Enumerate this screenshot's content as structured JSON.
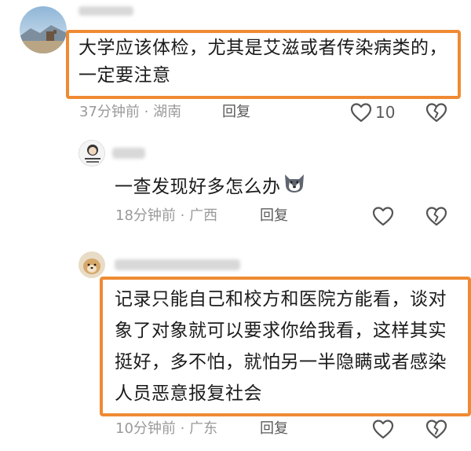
{
  "comments": [
    {
      "text": "大学应该体检，尤其是艾滋或者传染病类的，一定要注意",
      "time": "37分钟前",
      "location": "湖南",
      "reply_label": "回复",
      "like_count": "10"
    },
    {
      "text": "一查发现好多怎么办",
      "emoji": "husky-emoji",
      "time": "18分钟前",
      "location": "广西",
      "reply_label": "回复"
    },
    {
      "text": "记录只能自己和校方和医院方能看，谈对象了对象就可以要求你给我看，这样其实挺好，多不怕，就怕另一半隐瞒或者感染人员恶意报复社会",
      "time": "10分钟前",
      "location": "广东",
      "reply_label": "回复"
    }
  ],
  "meta_separator": " · ",
  "icons": {
    "like": "heart-outline-icon",
    "dislike": "broken-heart-icon"
  },
  "colors": {
    "highlight": "#ef8a33",
    "meta": "#9a9a9a",
    "text": "#1b1b1b"
  }
}
